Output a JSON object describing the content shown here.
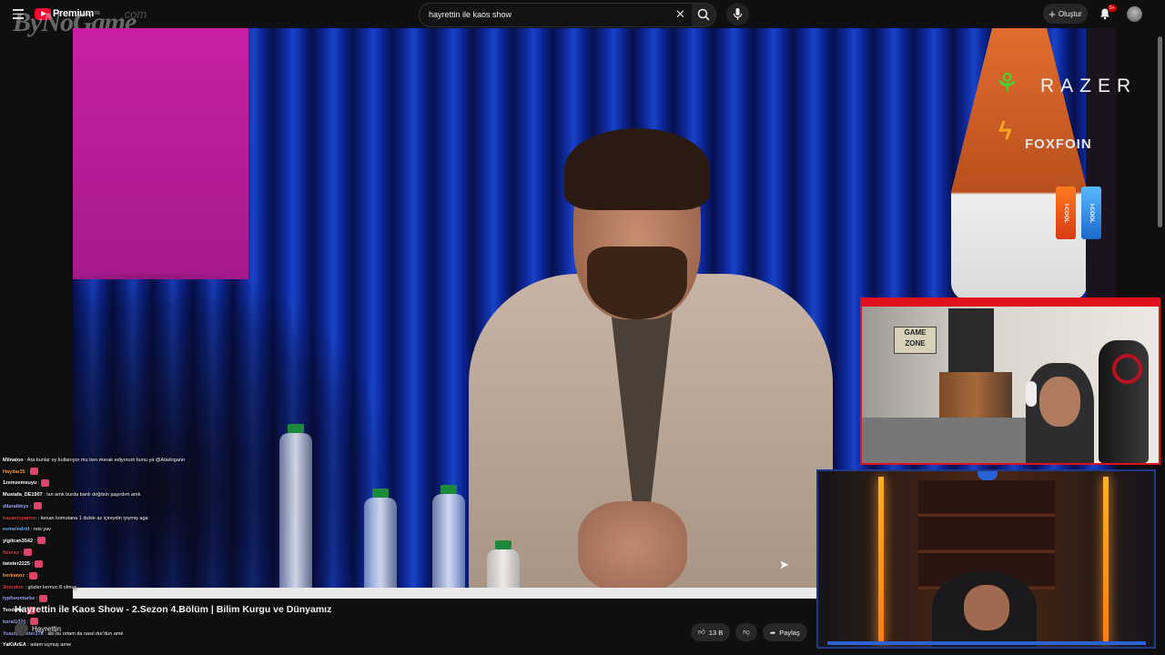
{
  "header": {
    "brand": "Premium",
    "brand_tm": "TR",
    "search_value": "hayrettin ile kaos show",
    "create_label": "Oluştur",
    "notifications_badge": "9+"
  },
  "watermark": {
    "text": "ByNoGame",
    "suffix": ".com"
  },
  "sponsors": {
    "razer": "RAZER",
    "foxfoin": "FOXFOIN",
    "cool_left": "I-COOL",
    "cool_right": "I-COOL"
  },
  "webcam": {
    "sign": "GAME ZONE"
  },
  "chat": [
    {
      "user": "Milnatoo",
      "msg": ": Ata bunlar oy kullanıyor mu ben merak ediyorum bunu ya @Atadogann",
      "color": "#ffffff",
      "emote": false
    },
    {
      "user": "Haydar35",
      "msg": ":",
      "color": "#ff9a3c",
      "emote": true
    },
    {
      "user": "1zemzemsuyu",
      "msg": ":",
      "color": "#ffffff",
      "emote": true
    },
    {
      "user": "Mustafa_DE1907",
      "msg": ": lan amk burda banlı değilsin şaşırdım amk",
      "color": "#ffffff",
      "emote": false
    },
    {
      "user": "dilaraikkys",
      "msg": ":",
      "color": "#9fa8ff",
      "emote": true
    },
    {
      "user": "hasanispannn",
      "msg": ": kenan komutana 1 duble az içireydin iyiymiş aga",
      "color": "#e03c3c",
      "emote": false
    },
    {
      "user": "esmeindrid",
      "msg": ": reis yav",
      "color": "#6ab0ff",
      "emote": false
    },
    {
      "user": "yigitcan3542",
      "msg": ":",
      "color": "#ffffff",
      "emote": true
    },
    {
      "user": "fblerax",
      "msg": ":",
      "color": "#e03c3c",
      "emote": true
    },
    {
      "user": "twister2225",
      "msg": ":",
      "color": "#ffffff",
      "emote": true
    },
    {
      "user": "berkanoz",
      "msg": ":",
      "color": "#ff9a3c",
      "emote": true
    },
    {
      "user": "3mindon",
      "msg": ": gözler kırmızı 8 olmuş",
      "color": "#e03c3c",
      "emote": false
    },
    {
      "user": "typhoonturks",
      "msg": ":",
      "color": "#9fa8ff",
      "emote": true
    },
    {
      "user": "Teodoks",
      "msg": ":",
      "color": "#ffffff",
      "emote": true
    },
    {
      "user": "koral1020",
      "msg": ":",
      "color": "#9fa8ff",
      "emote": true
    },
    {
      "user": "Yusufprtester378",
      "msg": ": abi bu ortam da nasıl dur'dun amk",
      "color": "#9fa8ff",
      "emote": false
    },
    {
      "user": "YaKlArEA",
      "msg": ": adam uçmuş amw",
      "color": "#ffffff",
      "emote": false
    }
  ],
  "video": {
    "title": "Hayrettin ile Kaos Show - 2.Sezon 4.Bölüm | Bilim Kurgu ve Dünyamız",
    "channel": "Hayrettin",
    "likes": "13 B",
    "share_label": "Paylaş"
  }
}
